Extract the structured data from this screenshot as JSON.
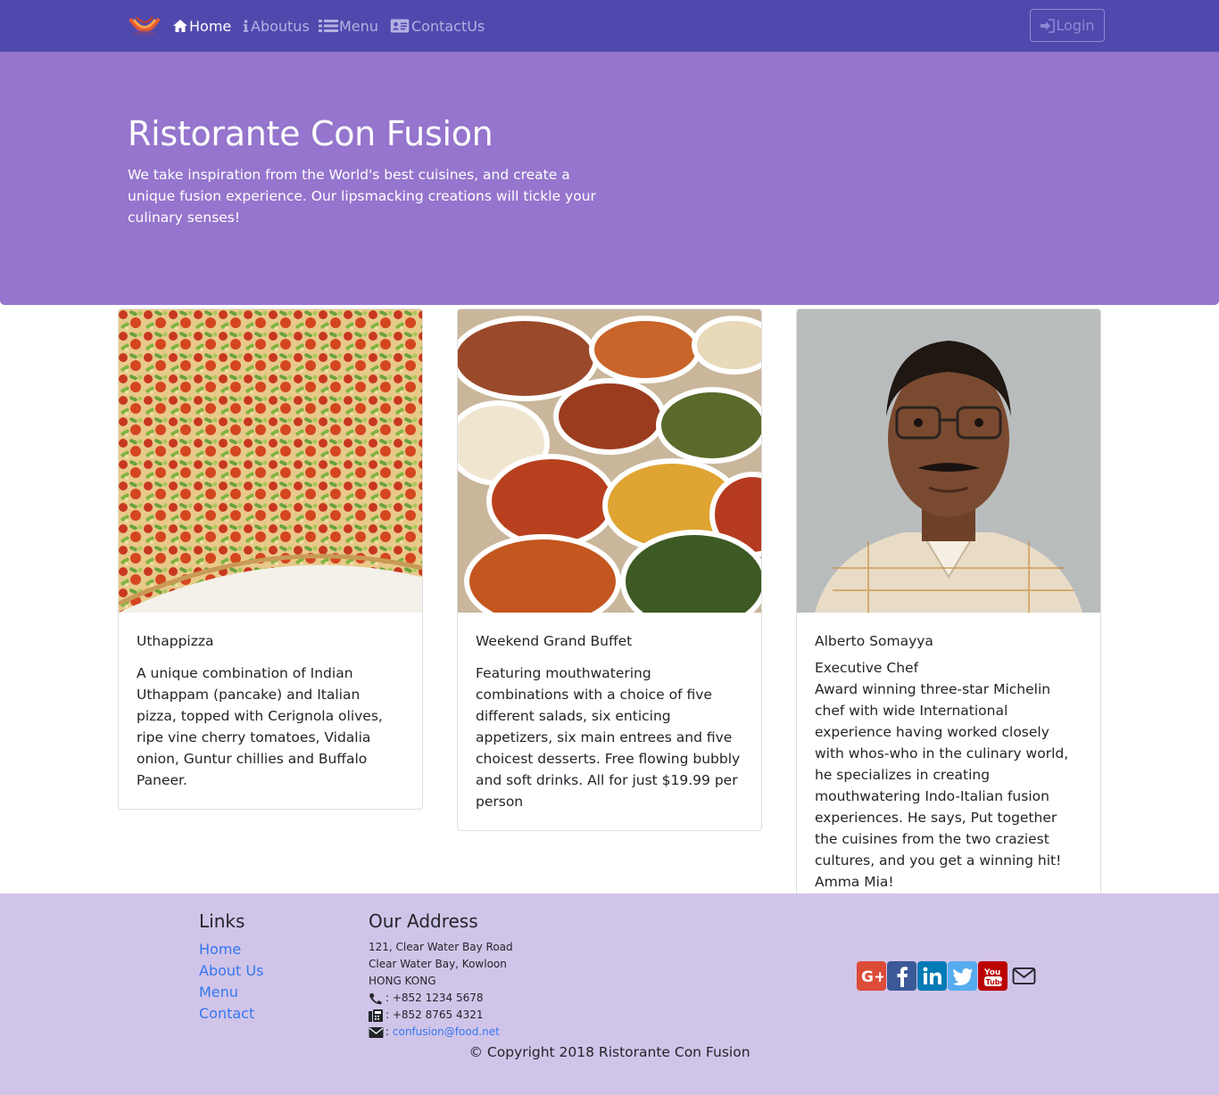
{
  "nav": {
    "items": [
      {
        "label": "Home",
        "icon": "home-icon",
        "active": true
      },
      {
        "label": "Aboutus",
        "icon": "info-icon",
        "active": false
      },
      {
        "label": "Menu",
        "icon": "list-icon",
        "active": false
      },
      {
        "label": "ContactUs",
        "icon": "address-card-icon",
        "active": false
      }
    ],
    "login_label": "Login"
  },
  "jumbotron": {
    "title": "Ristorante Con Fusion",
    "text": "We take inspiration from the World's best cuisines, and create a unique fusion experience. Our lipsmacking creations will tickle your culinary senses!"
  },
  "cards": [
    {
      "title": "Uthappizza",
      "subtitle": "",
      "text": "A unique combination of Indian Uthappam (pancake) and Italian pizza, topped with Cerignola olives, ripe vine cherry tomatoes, Vidalia onion, Guntur chillies and Buffalo Paneer."
    },
    {
      "title": "Weekend Grand Buffet",
      "subtitle": "",
      "text": "Featuring mouthwatering combinations with a choice of five different salads, six enticing appetizers, six main entrees and five choicest desserts. Free flowing bubbly and soft drinks. All for just $19.99 per person"
    },
    {
      "title": "Alberto Somayya",
      "subtitle": "Executive Chef",
      "text": "Award winning three-star Michelin chef with wide International experience having worked closely with whos-who in the culinary world, he specializes in creating mouthwatering Indo-Italian fusion experiences. He says, Put together the cuisines from the two craziest cultures, and you get a winning hit! Amma Mia!"
    }
  ],
  "footer": {
    "links_heading": "Links",
    "links": [
      "Home",
      "About Us",
      "Menu",
      "Contact"
    ],
    "address_heading": "Our Address",
    "address_lines": [
      "121, Clear Water Bay Road",
      "Clear Water Bay, Kowloon",
      "HONG KONG"
    ],
    "phone": ": +852 1234 5678",
    "fax": ": +852 8765 4321",
    "email_prefix": ":",
    "email": "confusion@food.net",
    "social": [
      {
        "icon": "google-plus-icon",
        "color": "#dd4b39"
      },
      {
        "icon": "facebook-icon",
        "color": "#3b5998"
      },
      {
        "icon": "linkedin-icon",
        "color": "#007bb6"
      },
      {
        "icon": "twitter-icon",
        "color": "#55acee"
      },
      {
        "icon": "youtube-icon",
        "color": "#bb0000"
      },
      {
        "icon": "envelope-icon",
        "color": "#212529"
      }
    ],
    "copyright": "© Copyright 2018 Ristorante Con Fusion"
  },
  "colors": {
    "navbar": "#5049ad",
    "jumbotron": "#9575cd",
    "footer": "#d1c4e9",
    "link": "#3478f0"
  }
}
